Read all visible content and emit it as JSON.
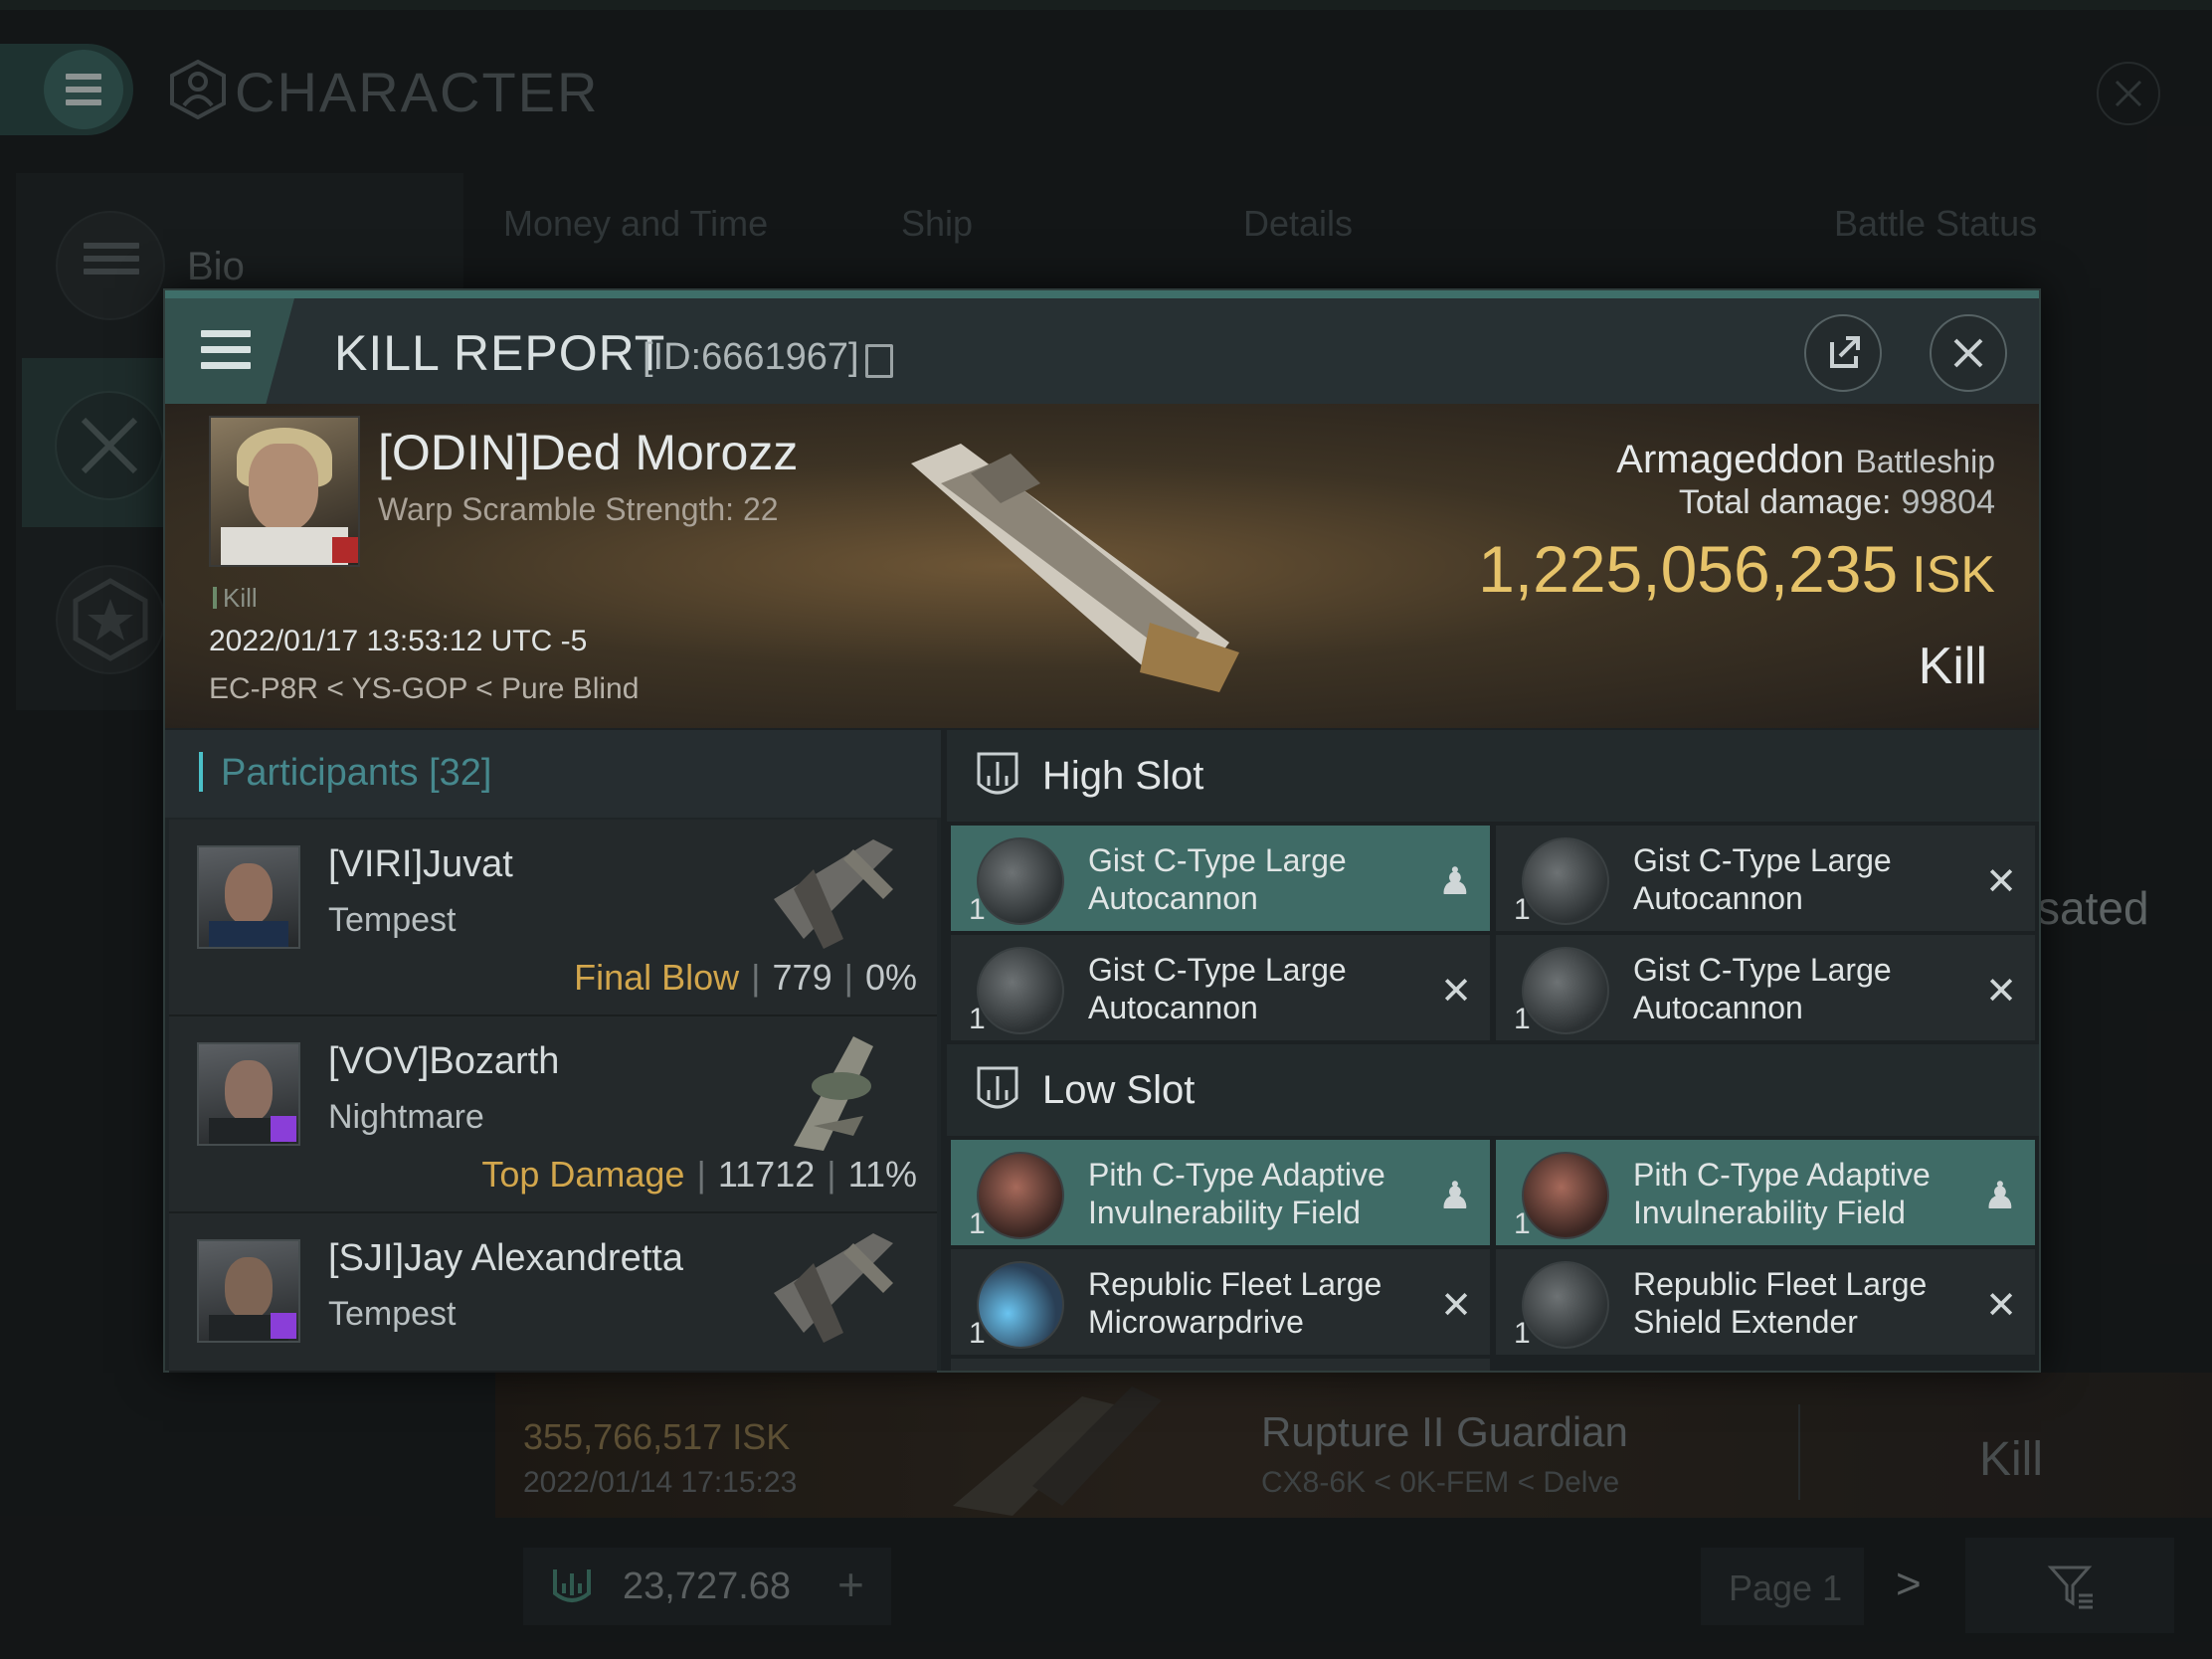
{
  "window": {
    "title": "CHARACTER",
    "nav": {
      "bio_label": "Bio"
    },
    "tabs": [
      "Money and Time",
      "Ship",
      "Details",
      "Battle Status"
    ],
    "background_right_text": "sated",
    "background_row": {
      "isk": "355,766,517 ISK",
      "date": "2022/01/14 17:15:23",
      "ship": "Rupture II Guardian",
      "location": "CX8-6K < 0K-FEM < Delve",
      "result": "Kill"
    },
    "bottom": {
      "value": "23,727.68",
      "page": "Page 1"
    }
  },
  "kill_report": {
    "title": "KILL REPORT",
    "id": "[ID:6661967]",
    "victim": {
      "name": "[ODIN]Ded Morozz",
      "warp_scramble": "Warp Scramble Strength: 22",
      "tag": "Kill",
      "datetime": "2022/01/17 13:53:12 UTC -5",
      "location": "EC-P8R < YS-GOP < Pure Blind",
      "ship": "Armageddon",
      "ship_class": "Battleship",
      "total_damage_label": "Total damage:",
      "total_damage": "99804",
      "isk_value": "1,225,056,235",
      "isk_unit": "ISK",
      "result": "Kill"
    },
    "participants": {
      "label": "Participants",
      "count": "[32]",
      "rows": [
        {
          "name": "[VIRI]Juvat",
          "ship": "Tempest",
          "label": "Final Blow",
          "damage": "779",
          "percent": "0%"
        },
        {
          "name": "[VOV]Bozarth",
          "ship": "Nightmare",
          "label": "Top Damage",
          "damage": "11712",
          "percent": "11%"
        },
        {
          "name": "[SJI]Jay Alexandretta",
          "ship": "Tempest",
          "label": "",
          "damage": "",
          "percent": ""
        }
      ]
    },
    "high_slot": {
      "label": "High Slot",
      "modules": [
        {
          "name": "Gist C-Type Large Autocannon",
          "qty": "1",
          "state": "dropped"
        },
        {
          "name": "Gist C-Type Large Autocannon",
          "qty": "1",
          "state": "destroyed"
        },
        {
          "name": "Gist C-Type Large Autocannon",
          "qty": "1",
          "state": "destroyed"
        },
        {
          "name": "Gist C-Type Large Autocannon",
          "qty": "1",
          "state": "destroyed"
        }
      ]
    },
    "low_slot": {
      "label": "Low Slot",
      "modules": [
        {
          "name": "Pith C-Type Adaptive Invulnerability Field",
          "qty": "1",
          "state": "dropped"
        },
        {
          "name": "Pith C-Type Adaptive Invulnerability Field",
          "qty": "1",
          "state": "dropped"
        },
        {
          "name": "Republic Fleet Large Microwarpdrive",
          "qty": "1",
          "state": "destroyed"
        },
        {
          "name": "Republic Fleet Large Shield Extender",
          "qty": "1",
          "state": "destroyed"
        }
      ]
    },
    "colors": {
      "accent": "#3f6b66",
      "isk": "#e6c36a",
      "participants": "#46888d",
      "final_blow": "#d2a64c"
    }
  }
}
